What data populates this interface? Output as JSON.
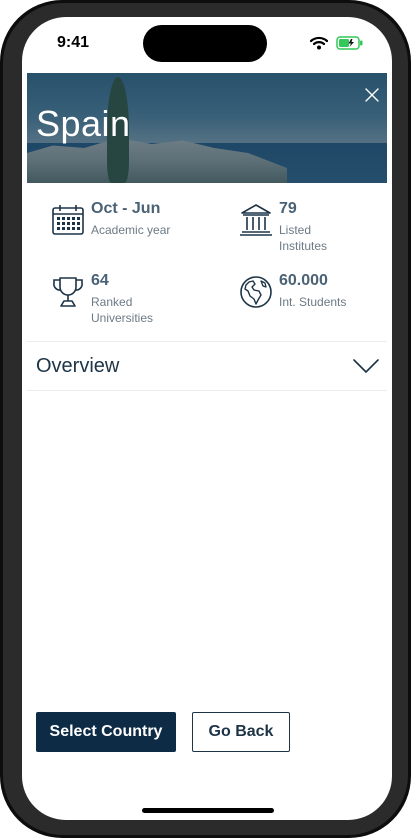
{
  "status_bar": {
    "time": "9:41"
  },
  "hero": {
    "country": "Spain",
    "close_icon": "close-icon"
  },
  "stats": [
    {
      "icon": "calendar-icon",
      "value": "Oct - Jun",
      "label": "Academic year"
    },
    {
      "icon": "institute-building-icon",
      "value": "79",
      "label": "Listed Institutes"
    },
    {
      "icon": "trophy-icon",
      "value": "64",
      "label": "Ranked Universities"
    },
    {
      "icon": "globe-icon",
      "value": "60.000",
      "label": "Int. Students"
    }
  ],
  "overview": {
    "title": "Overview",
    "icon": "chevron-down-icon"
  },
  "actions": {
    "select_label": "Select Country",
    "back_label": "Go Back"
  },
  "colors": {
    "primary": "#0d2b45",
    "text_dark": "#1d3447",
    "muted": "#6c7a86"
  }
}
